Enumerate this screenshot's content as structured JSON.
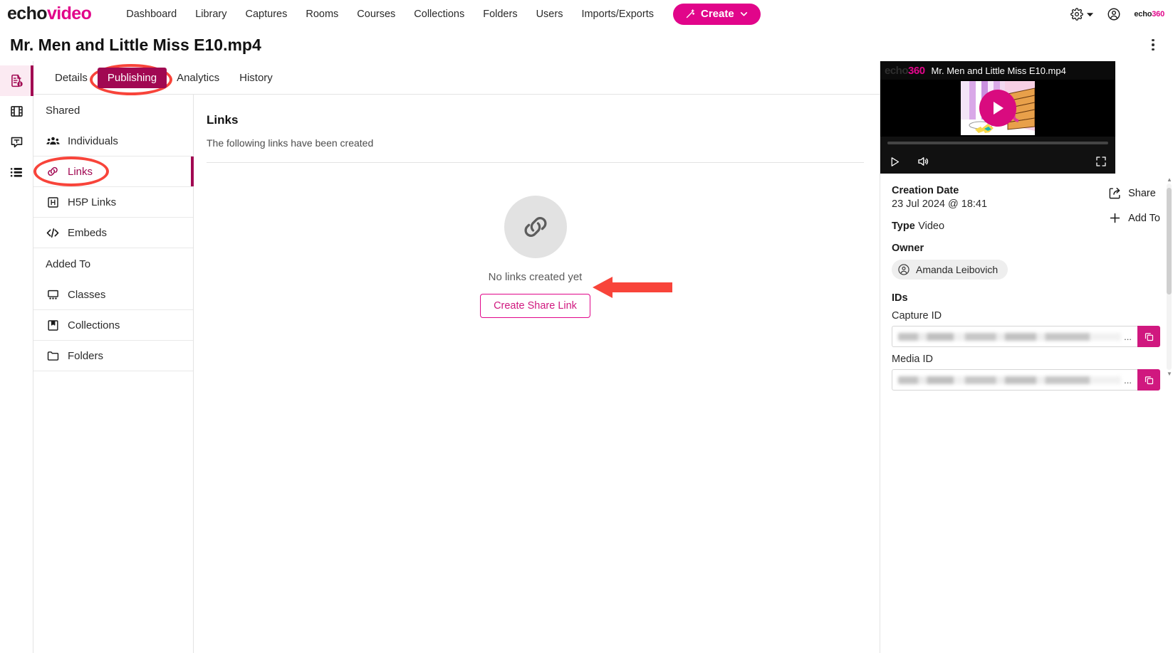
{
  "brand": {
    "part1": "echo",
    "part2": "video"
  },
  "topnav": {
    "links": [
      {
        "label": "Dashboard"
      },
      {
        "label": "Library"
      },
      {
        "label": "Captures"
      },
      {
        "label": "Rooms"
      },
      {
        "label": "Courses"
      },
      {
        "label": "Collections"
      },
      {
        "label": "Folders"
      },
      {
        "label": "Users"
      },
      {
        "label": "Imports/Exports"
      }
    ],
    "create_label": "Create",
    "settings_icon": "gear-icon",
    "account_icon": "user-circle-icon",
    "org_logo": {
      "part1": "echo",
      "part2": "360"
    }
  },
  "header": {
    "title": "Mr. Men and Little Miss E10.mp4",
    "overflow_icon": "kebab-menu-icon"
  },
  "rail": {
    "items": [
      {
        "icon": "document-info-icon",
        "name": "details",
        "active": true
      },
      {
        "icon": "film-strip-icon",
        "name": "media",
        "active": false
      },
      {
        "icon": "caption-text-icon",
        "name": "transcript",
        "active": false
      },
      {
        "icon": "outline-list-icon",
        "name": "chapters",
        "active": false
      }
    ]
  },
  "tabs": [
    {
      "label": "Details",
      "active": false
    },
    {
      "label": "Publishing",
      "active": true
    },
    {
      "label": "Analytics",
      "active": false
    },
    {
      "label": "History",
      "active": false
    }
  ],
  "subnav": {
    "group1_title": "Shared",
    "group2_title": "Added To",
    "items_shared": [
      {
        "label": "Individuals",
        "icon": "people-group-icon",
        "active": false
      },
      {
        "label": "Links",
        "icon": "link-chain-icon",
        "active": true
      },
      {
        "label": "H5P Links",
        "icon": "h5p-icon",
        "active": false
      },
      {
        "label": "Embeds",
        "icon": "code-brackets-icon",
        "active": false
      }
    ],
    "items_added": [
      {
        "label": "Classes",
        "icon": "classroom-icon",
        "active": false
      },
      {
        "label": "Collections",
        "icon": "book-bookmark-icon",
        "active": false
      },
      {
        "label": "Folders",
        "icon": "folder-icon",
        "active": false
      }
    ]
  },
  "main": {
    "title": "Links",
    "subtitle": "The following links have been created",
    "empty_icon": "link-chain-icon",
    "empty_text": "No links created yet",
    "create_button": "Create Share Link"
  },
  "player": {
    "logo": {
      "part1": "echo",
      "part2": "360"
    },
    "title": "Mr. Men and Little Miss E10.mp4",
    "play_overlay_icon": "play-icon",
    "controls": [
      {
        "icon": "play-icon",
        "name": "play-button"
      },
      {
        "icon": "volume-icon",
        "name": "volume-button"
      },
      {
        "icon": "fullscreen-icon",
        "name": "fullscreen-button"
      }
    ]
  },
  "details": {
    "creation_date_label": "Creation Date",
    "creation_date_value": "23 Jul 2024 @ 18:41",
    "type_label": "Type",
    "type_value": "Video",
    "owner_label": "Owner",
    "owner_name": "Amanda Leibovich",
    "owner_icon": "user-circle-icon",
    "ids_label": "IDs",
    "capture_id_label": "Capture ID",
    "capture_id_value": "",
    "capture_id_ellipsis": "...",
    "media_id_label": "Media ID",
    "media_id_value": "",
    "media_id_ellipsis": "...",
    "copy_icon": "copy-icon",
    "actions": [
      {
        "label": "Share",
        "icon": "share-icon"
      },
      {
        "label": "Add To",
        "icon": "plus-icon"
      }
    ]
  },
  "annotations": {
    "oval_publishing": "red-oval-highlight",
    "oval_links": "red-oval-highlight",
    "arrow_create_link": "red-arrow-pointer"
  },
  "colors": {
    "brand_pink": "#e1058a",
    "active_tab_bg": "#a10852",
    "annotation_red": "#f8443a",
    "link_pink": "#d0187f"
  }
}
